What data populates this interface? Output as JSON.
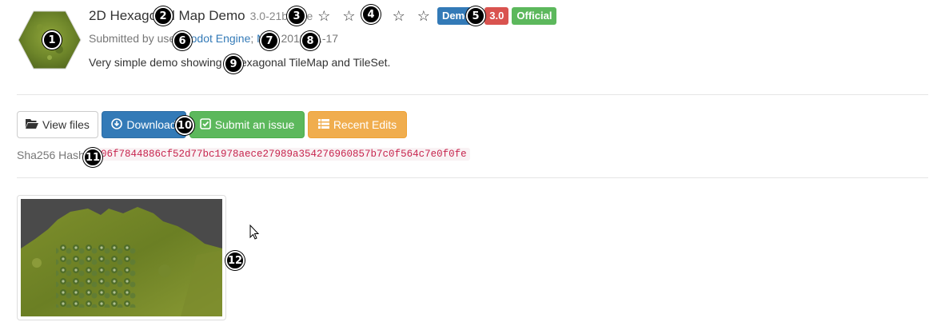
{
  "asset": {
    "title": "2D Hexagonal Map Demo",
    "version": "3.0-21b783e",
    "stars": "☆ ☆ ☆ ☆ ☆",
    "badges": [
      {
        "label": "Demos",
        "color": "#337ab7"
      },
      {
        "label": "3.0",
        "color": "#d9534f"
      },
      {
        "label": "Official",
        "color": "#5cb85c"
      }
    ],
    "submitted_prefix": "Submitted by user ",
    "author": "Godot Engine",
    "separator": "; ",
    "license": "MIT",
    "date": ", 2018-01-17",
    "description": "Very simple demo showing a hexagonal TileMap and TileSet."
  },
  "actions": {
    "view_files": "View files",
    "download": "Download",
    "submit_issue": "Submit an issue",
    "recent_edits": "Recent Edits"
  },
  "hash": {
    "label": "Sha256 Hash: ",
    "value": "d506f7844886cf52d77bc1978aece27989a354276960857b7c0f564c7e0f0fe"
  },
  "markers": [
    "1",
    "2",
    "3",
    "4",
    "5",
    "6",
    "7",
    "8",
    "9",
    "10",
    "11",
    "12"
  ],
  "icons": {
    "folder": "folder-open-icon",
    "download": "download-circle-icon",
    "issue": "check-square-icon",
    "edits": "list-icon",
    "cursor": "mouse-cursor-icon"
  }
}
